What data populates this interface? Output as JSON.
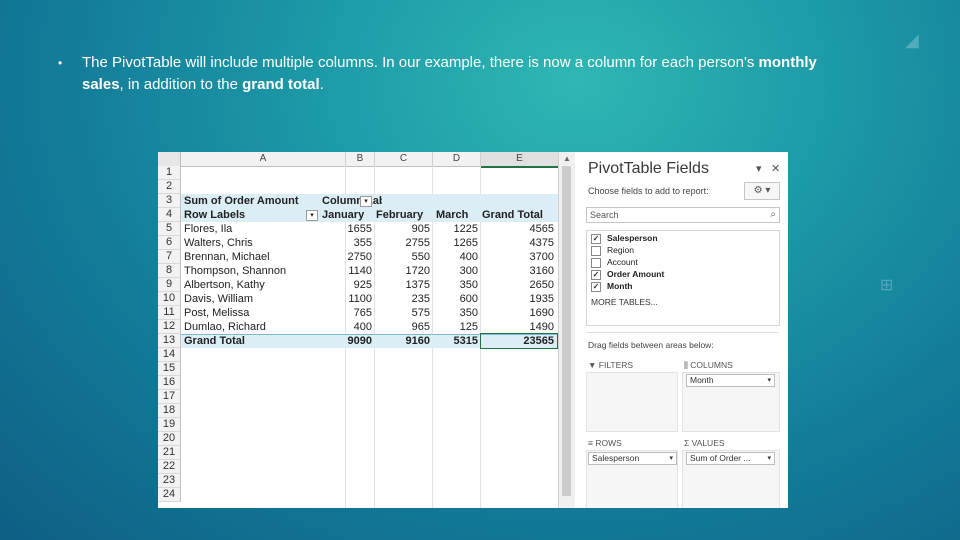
{
  "slide": {
    "bullet_symbol": "•",
    "text_part1": "The PivotTable will include multiple columns. In our example, there is now a column for each person's ",
    "text_bold1": "monthly sales",
    "text_part2": ", in addition to the ",
    "text_bold2": "grand total",
    "text_part3": "."
  },
  "excel": {
    "columns": [
      "A",
      "B",
      "C",
      "D",
      "E"
    ],
    "row_numbers": [
      "1",
      "2",
      "3",
      "4",
      "5",
      "6",
      "7",
      "8",
      "9",
      "10",
      "11",
      "12",
      "13",
      "14",
      "15",
      "16",
      "17",
      "18",
      "19",
      "20",
      "21",
      "22",
      "23",
      "24"
    ],
    "sum_label": "Sum of Order Amount",
    "col_labels": "Column Labels",
    "header_row": [
      "Row Labels",
      "January",
      "February",
      "March",
      "Grand Total"
    ],
    "rows": [
      [
        "Flores, Ila",
        "1655",
        "905",
        "1225",
        "4565"
      ],
      [
        "Walters, Chris",
        "355",
        "2755",
        "1265",
        "4375"
      ],
      [
        "Brennan, Michael",
        "2750",
        "550",
        "400",
        "3700"
      ],
      [
        "Thompson, Shannon",
        "1140",
        "1720",
        "300",
        "3160"
      ],
      [
        "Albertson, Kathy",
        "925",
        "1375",
        "350",
        "2650"
      ],
      [
        "Davis, William",
        "1100",
        "235",
        "600",
        "1935"
      ],
      [
        "Post, Melissa",
        "765",
        "575",
        "350",
        "1690"
      ],
      [
        "Dumlao, Richard",
        "400",
        "965",
        "125",
        "1490"
      ]
    ],
    "grand_total_row": [
      "Grand Total",
      "9090",
      "9160",
      "5315",
      "23565"
    ]
  },
  "pane": {
    "title": "PivotTable Fields",
    "subtitle": "Choose fields to add to report:",
    "search_placeholder": "Search",
    "fields": [
      {
        "label": "Salesperson",
        "checked": true
      },
      {
        "label": "Region",
        "checked": false
      },
      {
        "label": "Account",
        "checked": false
      },
      {
        "label": "Order Amount",
        "checked": true
      },
      {
        "label": "Month",
        "checked": true
      }
    ],
    "more_tables": "MORE TABLES...",
    "drag_label": "Drag fields between areas below:",
    "filters_label": "FILTERS",
    "columns_label": "COLUMNS",
    "rows_label": "ROWS",
    "values_label": "VALUES",
    "columns_item": "Month",
    "rows_item": "Salesperson",
    "values_item": "Sum of Order ..."
  },
  "colors": {
    "accent": "#217346",
    "header_band": "#dbeef6"
  },
  "icons": {
    "close": "close-icon",
    "dropdown": "chevron-down-icon",
    "settings": "gear-icon",
    "search": "search-icon"
  }
}
